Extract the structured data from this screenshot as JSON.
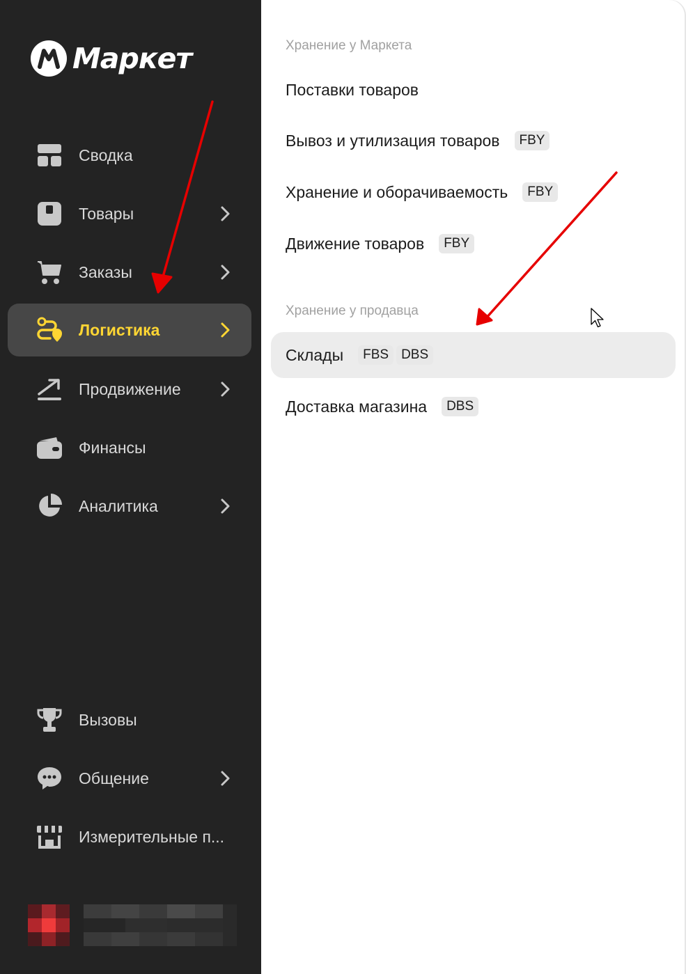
{
  "brand": {
    "name": "Маркет"
  },
  "sidebar": {
    "items": [
      {
        "id": "svodka",
        "label": "Сводка",
        "icon": "dashboard-icon",
        "chevron": false,
        "active": false
      },
      {
        "id": "tovary",
        "label": "Товары",
        "icon": "box-icon",
        "chevron": true,
        "active": false
      },
      {
        "id": "zakazy",
        "label": "Заказы",
        "icon": "cart-icon",
        "chevron": true,
        "active": false
      },
      {
        "id": "logistika",
        "label": "Логистика",
        "icon": "route-icon",
        "chevron": true,
        "active": true
      },
      {
        "id": "prodvizhenie",
        "label": "Продвижение",
        "icon": "trend-icon",
        "chevron": true,
        "active": false
      },
      {
        "id": "finansy",
        "label": "Финансы",
        "icon": "wallet-icon",
        "chevron": false,
        "active": false
      },
      {
        "id": "analitika",
        "label": "Аналитика",
        "icon": "pie-chart-icon",
        "chevron": true,
        "active": false
      },
      {
        "id": "vyzovy",
        "label": "Вызовы",
        "icon": "trophy-icon",
        "chevron": false,
        "active": false
      },
      {
        "id": "obshchenie",
        "label": "Общение",
        "icon": "chat-icon",
        "chevron": true,
        "active": false
      },
      {
        "id": "izmeritelnye",
        "label": "Измерительные п...",
        "icon": "store-icon",
        "chevron": false,
        "active": false
      }
    ]
  },
  "submenu": {
    "section_market": "Хранение у Маркета",
    "market_items": [
      {
        "label": "Поставки товаров",
        "badges": []
      },
      {
        "label": "Вывоз и утилизация товаров",
        "badges": [
          "FBY"
        ]
      },
      {
        "label": "Хранение и оборачиваемость",
        "badges": [
          "FBY"
        ]
      },
      {
        "label": "Движение товаров",
        "badges": [
          "FBY"
        ]
      }
    ],
    "section_seller": "Хранение у продавца",
    "seller_items": [
      {
        "label": "Склады",
        "badges": [
          "FBS",
          "DBS"
        ],
        "hover": true
      },
      {
        "label": "Доставка магазина",
        "badges": [
          "DBS"
        ]
      }
    ]
  },
  "colors": {
    "sidebar_bg": "#232323",
    "active_bg": "#474747",
    "active_accent": "#ffd633",
    "arrow": "#e60000"
  }
}
